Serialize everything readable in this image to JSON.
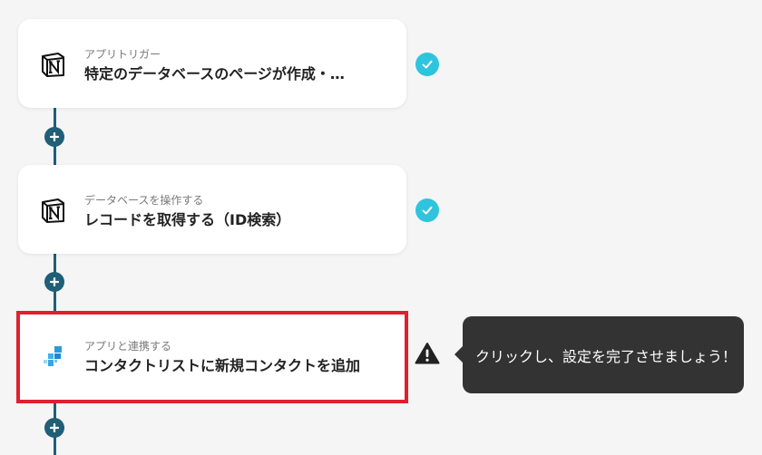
{
  "flow": {
    "steps": [
      {
        "subtitle": "アプリトリガー",
        "title": "特定のデータベースのページが作成・…",
        "app_icon": "notion-icon",
        "status": "complete"
      },
      {
        "subtitle": "データベースを操作する",
        "title": "レコードを取得する（ID検索）",
        "app_icon": "notion-icon",
        "status": "complete"
      },
      {
        "subtitle": "アプリと連携する",
        "title": "コンタクトリストに新規コンタクトを追加",
        "app_icon": "blue-squares-app-icon",
        "status": "incomplete"
      }
    ],
    "tooltip": "クリックし、設定を完了させましょう！"
  },
  "colors": {
    "connector": "#1f5f77",
    "check": "#2ec4dd",
    "highlight_border": "#e0202f",
    "tooltip_bg": "#333333",
    "background": "#f5f5f5"
  }
}
